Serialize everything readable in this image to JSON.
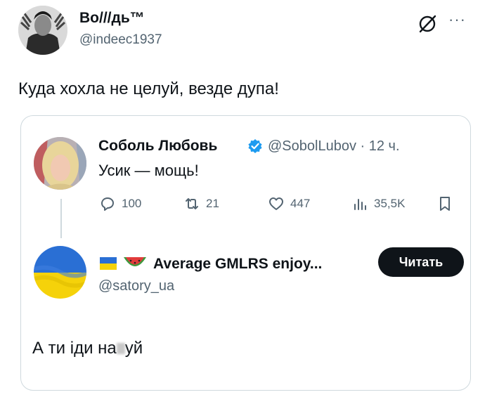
{
  "author": {
    "name": "Во///дь™",
    "handle": "@indeec1937"
  },
  "tweet": {
    "text": "Куда хохла не целуй, везде дупа!"
  },
  "quoted_first": {
    "name": "Соболь Любовь",
    "handle": "@SobolLubov · 12 ч.",
    "text": "Усик — мощь!",
    "actions": {
      "replies": "100",
      "retweets": "21",
      "likes": "447",
      "views": "35,5K"
    }
  },
  "quoted_second": {
    "name": "Average GMLRS enjoy...",
    "handle": "@satory_ua",
    "read_button": "Читать",
    "text_before": "А ти іди на",
    "text_after": "уй"
  },
  "colors": {
    "text": "#0f1419",
    "secondary": "#536471",
    "border": "#cfd9de",
    "verified": "#1d9bf0",
    "flag_blue": "#2a6fd4",
    "flag_yellow": "#f5d20a"
  },
  "icons": [
    "grok-icon",
    "more-icon",
    "verified-icon",
    "reply-icon",
    "retweet-icon",
    "like-icon",
    "views-icon",
    "bookmark-icon",
    "ukraine-flag-icon",
    "watermelon-icon"
  ]
}
